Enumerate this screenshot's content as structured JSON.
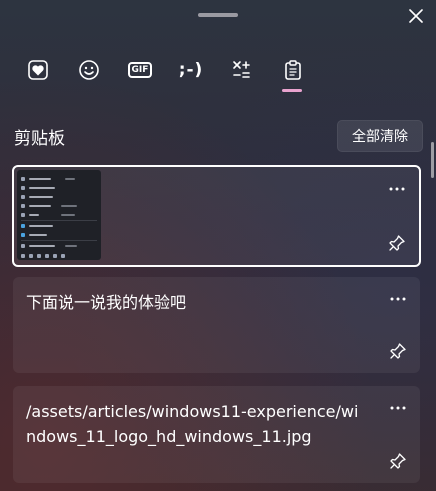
{
  "window": {
    "title": "剪贴板"
  },
  "tabs": [
    {
      "name": "favorites",
      "icon": "heart-icon",
      "active": false
    },
    {
      "name": "emoji",
      "icon": "smiley-icon",
      "active": false
    },
    {
      "name": "gif",
      "label": "GIF",
      "icon": "gif-icon",
      "active": false
    },
    {
      "name": "kaomoji",
      "label": ";-)",
      "icon": "kaomoji-icon",
      "active": false
    },
    {
      "name": "symbols",
      "icon": "symbols-icon",
      "active": false
    },
    {
      "name": "clipboard",
      "icon": "clipboard-icon",
      "active": true
    }
  ],
  "clipboard": {
    "title": "剪贴板",
    "clear_all_label": "全部清除",
    "items": [
      {
        "type": "image",
        "icon": "screenshot-thumbnail",
        "selected": true
      },
      {
        "type": "text",
        "text": "下面说一说我的体验吧",
        "selected": false
      },
      {
        "type": "text",
        "text": "/assets/articles/windows11-experience/windows_11_logo_hd_windows_11.jpg",
        "selected": false
      }
    ]
  },
  "colors": {
    "accent": "#e9a3cf",
    "card_border_selected": "#ffffff"
  }
}
